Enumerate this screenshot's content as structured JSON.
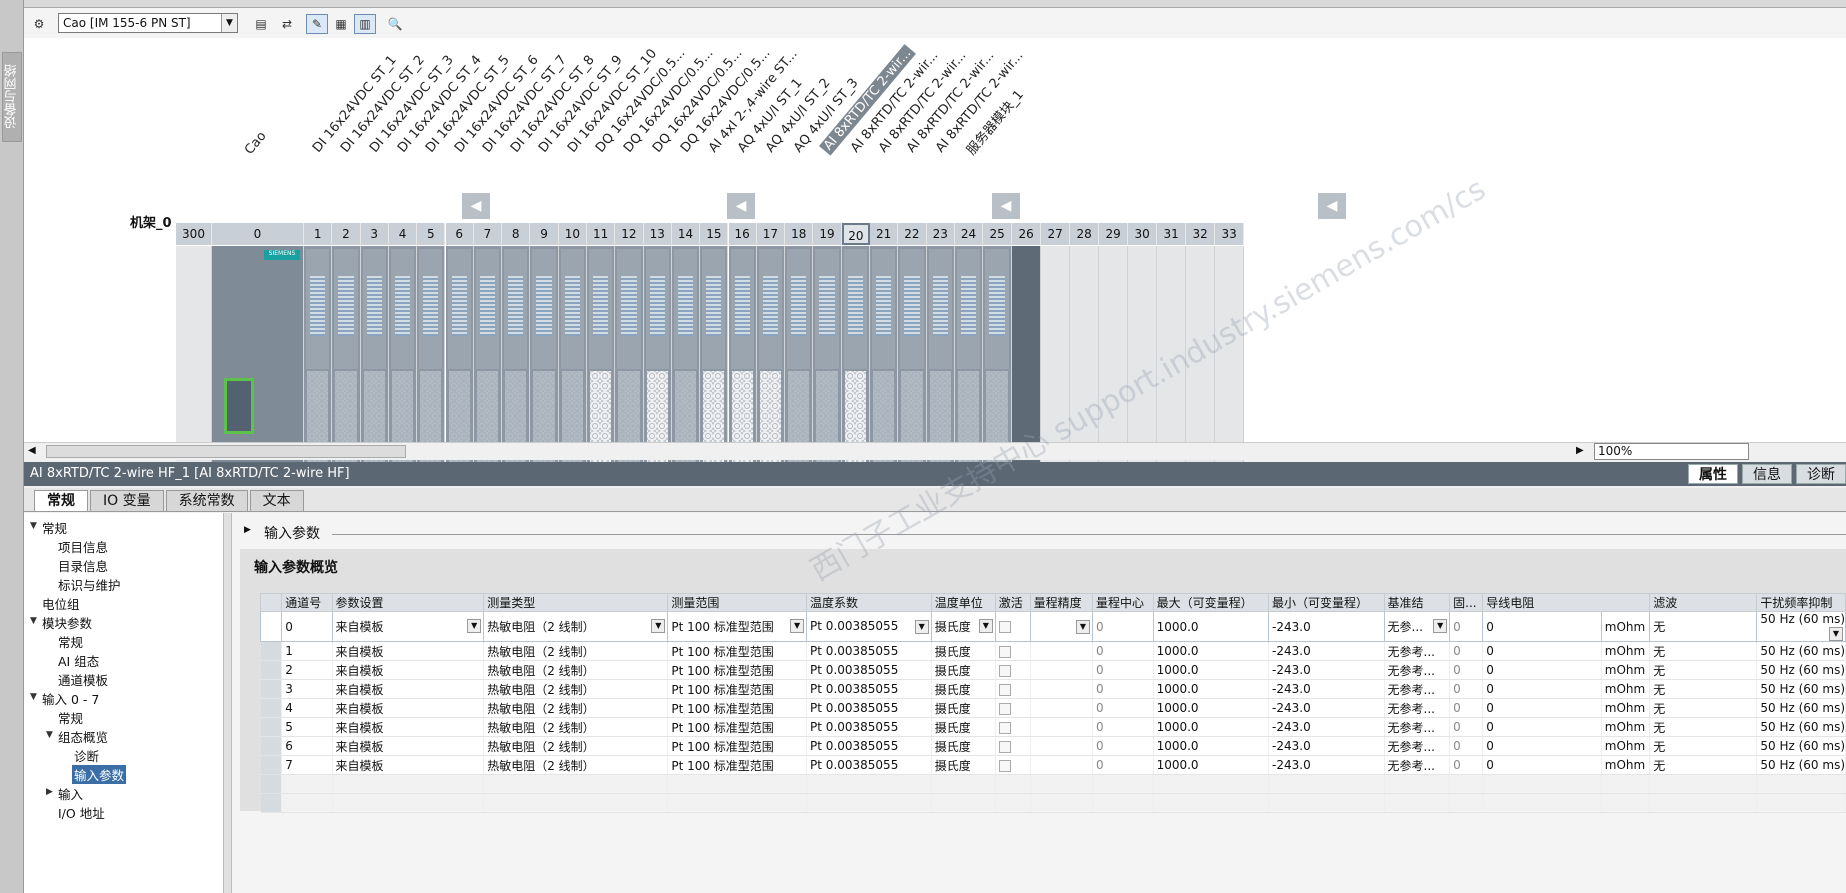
{
  "side_tab": "设备与网络",
  "toolbar": {
    "device_selector": "Cao [IM 155-6 PN ST]"
  },
  "rack": {
    "rack_label": "机架_0",
    "slot_numbers": [
      "300",
      "0",
      "1",
      "2",
      "3",
      "4",
      "5",
      "6",
      "7",
      "8",
      "9",
      "10",
      "11",
      "12",
      "13",
      "14",
      "15",
      "16",
      "17",
      "18",
      "19",
      "20",
      "21",
      "22",
      "23",
      "24",
      "25",
      "26",
      "27",
      "28",
      "29",
      "30",
      "31",
      "32",
      "33"
    ],
    "module_labels": [
      "Cao",
      "DI 16x24VDC ST_1",
      "DI 16x24VDC ST_2",
      "DI 16x24VDC ST_3",
      "DI 16x24VDC ST_4",
      "DI 16x24VDC ST_5",
      "DI 16x24VDC ST_6",
      "DI 16x24VDC ST_7",
      "DI 16x24VDC ST_8",
      "DI 16x24VDC ST_9",
      "DI 16x24VDC ST_10",
      "DQ 16x24VDC/0.5...",
      "DQ 16x24VDC/0.5...",
      "DQ 16x24VDC/0.5...",
      "DQ 16x24VDC/0.5...",
      "AI 4xI 2-,4-wire ST...",
      "AQ 4xU/I ST_1",
      "AQ 4xU/I ST_2",
      "AQ 4xU/I ST_3",
      "AI 8xRTD/TC 2-wir...",
      "AI 8xRTD/TC 2-wir...",
      "AI 8xRTD/TC 2-wir...",
      "AI 8xRTD/TC 2-wir...",
      "AI 8xRTD/TC 2-wir...",
      "服务器模块_1"
    ],
    "device_brand": "SIEMENS"
  },
  "zoom": "100%",
  "object_title": "AI 8xRTD/TC 2-wire HF_1 [AI 8xRTD/TC 2-wire HF]",
  "inspector_tabs": [
    "属性",
    "信息",
    "诊断"
  ],
  "prop_tabs": [
    "常规",
    "IO 变量",
    "系统常数",
    "文本"
  ],
  "tree": [
    "常规",
    "项目信息",
    "目录信息",
    "标识与维护",
    "电位组",
    "模块参数",
    "常规",
    "AI 组态",
    "通道模板",
    "输入 0 - 7",
    "常规",
    "组态概览",
    "诊断",
    "输入参数",
    "输入",
    "I/O 地址"
  ],
  "section_title": "输入参数",
  "panel_title": "输入参数概览",
  "table": {
    "headers": [
      "通道号",
      "参数设置",
      "测量类型",
      "测量范围",
      "温度系数",
      "温度单位",
      "激活",
      "量程精度",
      "量程中心",
      "最大（可变量程）",
      "最小（可变量程）",
      "基准结",
      "固...",
      "导线电阻",
      "滤波",
      "干扰频率抑制"
    ],
    "rows": [
      [
        "0",
        "来自模板",
        "热敏电阻（2 线制）",
        "Pt 100 标准型范围",
        "Pt 0.00385055",
        "摄氏度",
        "",
        "",
        "0",
        "1000.0",
        "-243.0",
        "无参...",
        "0",
        "0",
        "mOhm",
        "无",
        "50 Hz (60 ms)"
      ],
      [
        "1",
        "来自模板",
        "热敏电阻（2 线制）",
        "Pt 100 标准型范围",
        "Pt 0.00385055",
        "摄氏度",
        "",
        "",
        "0",
        "1000.0",
        "-243.0",
        "无参考...",
        "0",
        "0",
        "mOhm",
        "无",
        "50 Hz (60 ms)"
      ],
      [
        "2",
        "来自模板",
        "热敏电阻（2 线制）",
        "Pt 100 标准型范围",
        "Pt 0.00385055",
        "摄氏度",
        "",
        "",
        "0",
        "1000.0",
        "-243.0",
        "无参考...",
        "0",
        "0",
        "mOhm",
        "无",
        "50 Hz (60 ms)"
      ],
      [
        "3",
        "来自模板",
        "热敏电阻（2 线制）",
        "Pt 100 标准型范围",
        "Pt 0.00385055",
        "摄氏度",
        "",
        "",
        "0",
        "1000.0",
        "-243.0",
        "无参考...",
        "0",
        "0",
        "mOhm",
        "无",
        "50 Hz (60 ms)"
      ],
      [
        "4",
        "来自模板",
        "热敏电阻（2 线制）",
        "Pt 100 标准型范围",
        "Pt 0.00385055",
        "摄氏度",
        "",
        "",
        "0",
        "1000.0",
        "-243.0",
        "无参考...",
        "0",
        "0",
        "mOhm",
        "无",
        "50 Hz (60 ms)"
      ],
      [
        "5",
        "来自模板",
        "热敏电阻（2 线制）",
        "Pt 100 标准型范围",
        "Pt 0.00385055",
        "摄氏度",
        "",
        "",
        "0",
        "1000.0",
        "-243.0",
        "无参考...",
        "0",
        "0",
        "mOhm",
        "无",
        "50 Hz (60 ms)"
      ],
      [
        "6",
        "来自模板",
        "热敏电阻（2 线制）",
        "Pt 100 标准型范围",
        "Pt 0.00385055",
        "摄氏度",
        "",
        "",
        "0",
        "1000.0",
        "-243.0",
        "无参考...",
        "0",
        "0",
        "mOhm",
        "无",
        "50 Hz (60 ms)"
      ],
      [
        "7",
        "来自模板",
        "热敏电阻（2 线制）",
        "Pt 100 标准型范围",
        "Pt 0.00385055",
        "摄氏度",
        "",
        "",
        "0",
        "1000.0",
        "-243.0",
        "无参考...",
        "0",
        "0",
        "mOhm",
        "无",
        "50 Hz (60 ms)"
      ]
    ]
  },
  "watermark": "西门子工业支持中心 support.industry.siemens.com/cs"
}
